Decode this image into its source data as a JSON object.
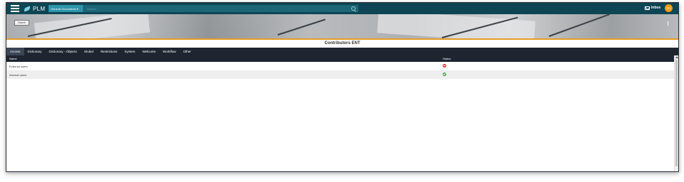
{
  "header": {
    "app_name": "PLM",
    "scope_label": "General Documents ▾",
    "search_placeholder": "Search",
    "inbox_label": "Inbox",
    "avatar_initials": "PO"
  },
  "banner": {
    "home_label": "Home"
  },
  "page": {
    "title": "Contributors ENT"
  },
  "tabs": [
    {
      "label": "Access"
    },
    {
      "label": "Dictionary"
    },
    {
      "label": "Dictionary - Objects"
    },
    {
      "label": "Global"
    },
    {
      "label": "Restrictions"
    },
    {
      "label": "System"
    },
    {
      "label": "Welcome"
    },
    {
      "label": "Workflow"
    },
    {
      "label": "Other"
    }
  ],
  "table": {
    "columns": {
      "name": "Name",
      "status": "Status"
    },
    "rows": [
      {
        "name": "External users",
        "status": "denied"
      },
      {
        "name": "Internal users",
        "status": "allowed"
      }
    ]
  },
  "colors": {
    "topbar": "#0e4555",
    "accent": "#e89c25",
    "tabbar": "#1e2530",
    "status_denied": "#d9332d",
    "status_allowed": "#3e9b44"
  }
}
